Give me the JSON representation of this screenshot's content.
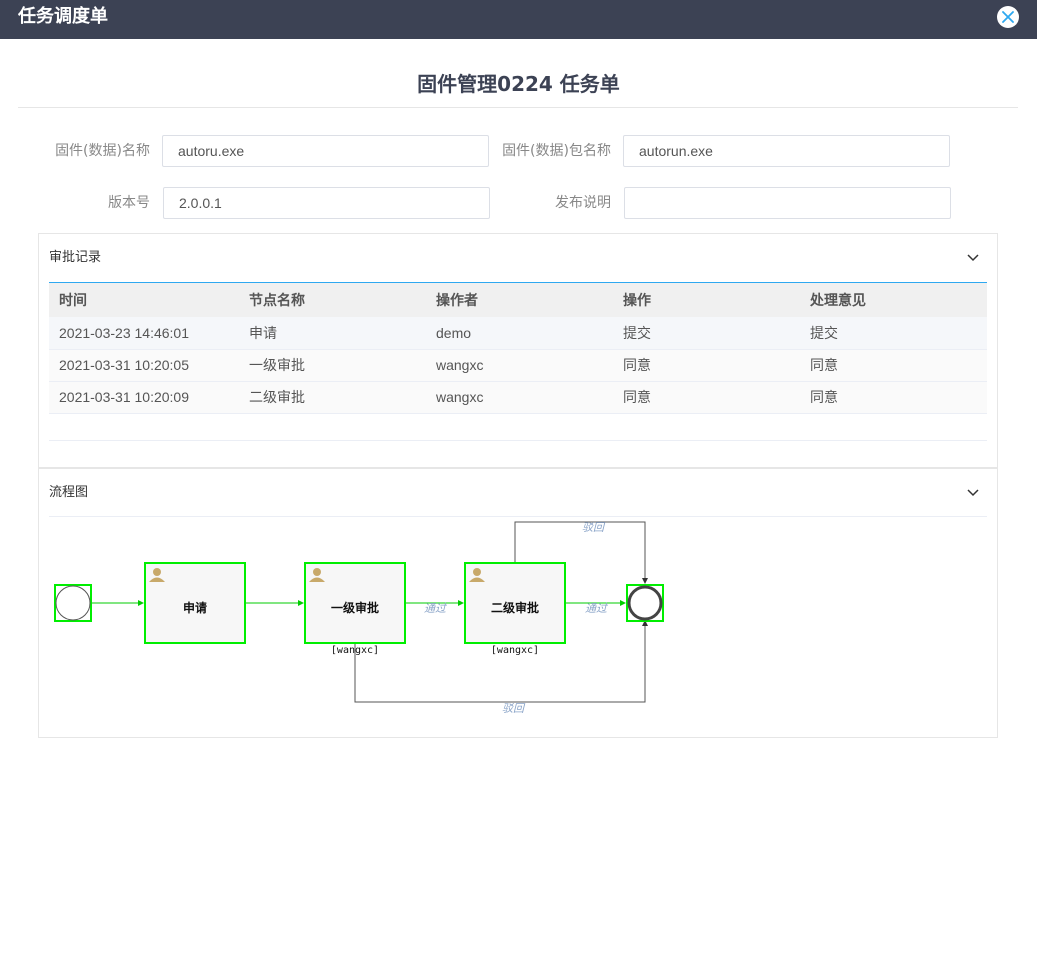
{
  "window": {
    "title": "任务调度单"
  },
  "page": {
    "title": "固件管理0224 任务单"
  },
  "form": {
    "firmware_name_label": "固件(数据)名称",
    "firmware_name_value": "autoru.exe",
    "package_name_label": "固件(数据)包名称",
    "package_name_value": "autorun.exe",
    "version_label": "版本号",
    "version_value": "2.0.0.1",
    "release_notes_label": "发布说明",
    "release_notes_value": ""
  },
  "approval": {
    "title": "审批记录",
    "columns": [
      "时间",
      "节点名称",
      "操作者",
      "操作",
      "处理意见"
    ],
    "rows": [
      [
        "2021-03-23 14:46:01",
        "申请",
        "demo",
        "提交",
        "提交"
      ],
      [
        "2021-03-31 10:20:05",
        "一级审批",
        "wangxc",
        "同意",
        "同意"
      ],
      [
        "2021-03-31 10:20:09",
        "二级审批",
        "wangxc",
        "同意",
        "同意"
      ]
    ]
  },
  "flow": {
    "title": "流程图",
    "nodes": {
      "apply": "申请",
      "level1": "一级审批",
      "level2": "二级审批"
    },
    "assignee1": "[wangxc]",
    "assignee2": "[wangxc]",
    "edges": {
      "pass1": "通过",
      "pass2": "通过",
      "reject_top": "驳回",
      "reject_bottom": "驳回"
    }
  },
  "colors": {
    "titlebar": "#3c4254",
    "accent": "#2ea8f0",
    "flow_active": "#00ee00",
    "close_icon": "#2ea8f0",
    "user_icon": "#c8a96a"
  }
}
